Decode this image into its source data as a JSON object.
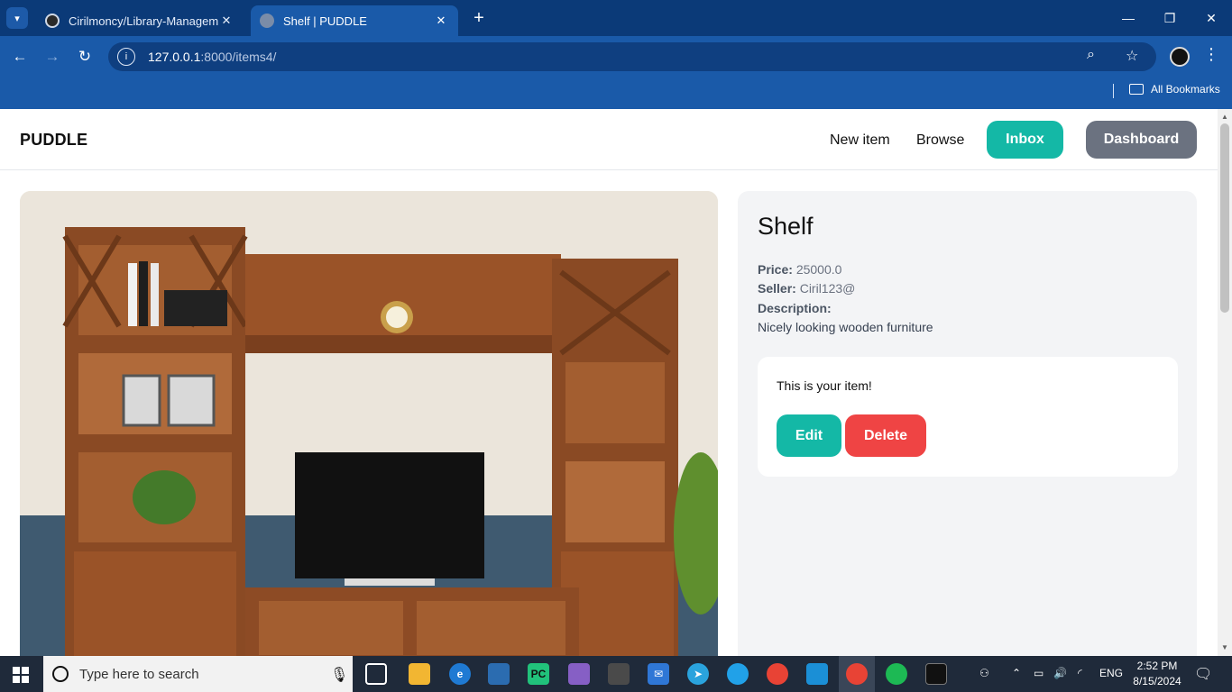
{
  "browser": {
    "tabs": [
      {
        "title": "Cirilmoncy/Library-Managemen",
        "active": false
      },
      {
        "title": "Shelf | PUDDLE",
        "active": true
      }
    ],
    "new_tab_icon": "plus-icon",
    "url_host": "127.0.0.1",
    "url_rest": ":8000/items4/",
    "bookmarks_label": "All Bookmarks"
  },
  "site": {
    "logo": "PUDDLE",
    "nav": {
      "new_item": "New item",
      "browse": "Browse",
      "inbox": "Inbox",
      "dashboard": "Dashboard"
    }
  },
  "item": {
    "name": "Shelf",
    "price_label": "Price:",
    "price": "25000.0",
    "seller_label": "Seller:",
    "seller": "Ciril123@",
    "description_label": "Description:",
    "description": "Nicely looking wooden furniture",
    "owner_notice": "This is your item!",
    "edit_label": "Edit",
    "delete_label": "Delete"
  },
  "taskbar": {
    "search_placeholder": "Type here to search",
    "language": "ENG",
    "time": "2:52 PM",
    "date": "8/15/2024"
  },
  "colors": {
    "accent_teal": "#14b8a6",
    "dashboard_gray": "#6b7280",
    "delete_red": "#ef4444",
    "browser_blue": "#1a5aa9"
  }
}
